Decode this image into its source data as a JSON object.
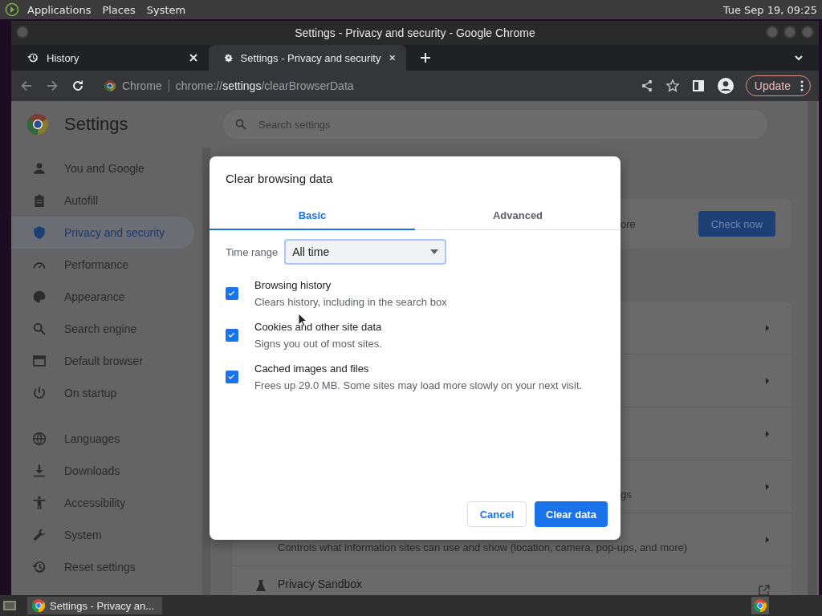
{
  "top_panel": {
    "menus": [
      "Applications",
      "Places",
      "System"
    ],
    "clock": "Tue Sep 19, 09:25"
  },
  "window": {
    "title": "Settings - Privacy and security - Google Chrome"
  },
  "tabs": [
    {
      "label": "History",
      "selected": false
    },
    {
      "label": "Settings - Privacy and security",
      "selected": true
    }
  ],
  "toolbar": {
    "site_label": "Chrome",
    "url": "chrome://**settings**/clearBrowserData",
    "update_button": "Update"
  },
  "settings": {
    "title": "Settings",
    "search": {
      "placeholder": "Search settings"
    },
    "sidebar": {
      "items": [
        {
          "label": "You and Google",
          "selected": false
        },
        {
          "label": "Autofill",
          "selected": false
        },
        {
          "label": "Privacy and security",
          "selected": true
        },
        {
          "label": "Performance",
          "selected": false
        },
        {
          "label": "Appearance",
          "selected": false
        },
        {
          "label": "Search engine",
          "selected": false
        },
        {
          "label": "Default browser",
          "selected": false
        },
        {
          "label": "On startup",
          "selected": false
        },
        {
          "label": "Languages",
          "selected": false
        },
        {
          "label": "Downloads",
          "selected": false
        },
        {
          "label": "Accessibility",
          "selected": false
        },
        {
          "label": "System",
          "selected": false
        },
        {
          "label": "Reset settings",
          "selected": false
        }
      ]
    },
    "safety_card": {
      "text_fragment": "ore",
      "button": "Check now"
    },
    "rows": [
      {
        "kind": "chevron"
      },
      {
        "kind": "chevron"
      },
      {
        "kind": "chevron"
      },
      {
        "kind": "chevron",
        "text_fragment": "gs"
      },
      {
        "kind": "chevron",
        "subtitle": "Controls what information sites can use and show (location, camera, pop-ups, and more)"
      },
      {
        "kind": "external",
        "title": "Privacy Sandbox"
      }
    ]
  },
  "dialog": {
    "title": "Clear browsing data",
    "tabs": [
      {
        "label": "Basic",
        "selected": true
      },
      {
        "label": "Advanced",
        "selected": false
      }
    ],
    "time_range": {
      "label": "Time range",
      "value": "All time"
    },
    "items": [
      {
        "title": "Browsing history",
        "description": "Clears history, including in the search box",
        "checked": true
      },
      {
        "title": "Cookies and other site data",
        "description": "Signs you out of most sites.",
        "checked": true
      },
      {
        "title": "Cached images and files",
        "description": "Frees up 29.0 MB. Some sites may load more slowly on your next visit.",
        "checked": true
      }
    ],
    "buttons": {
      "cancel": "Cancel",
      "confirm": "Clear data"
    }
  },
  "taskbar": {
    "task": "Settings - Privacy an..."
  }
}
